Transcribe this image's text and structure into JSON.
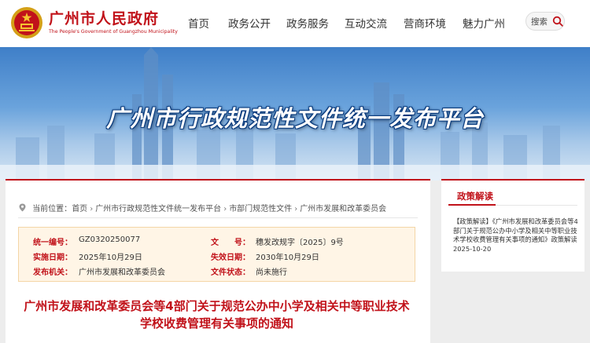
{
  "header": {
    "logo_cn": "广州市人民政府",
    "logo_en": "The People's Government of Guangzhou Municipality",
    "nav": [
      "首页",
      "政务公开",
      "政务服务",
      "互动交流",
      "营商环境",
      "魅力广州"
    ],
    "search_label": "搜索"
  },
  "banner": {
    "title": "广州市行政规范性文件统一发布平台"
  },
  "breadcrumb": {
    "prefix": "当前位置：",
    "items": [
      "首页",
      "广州市行政规范性文件统一发布平台",
      "市部门规范性文件",
      "广州市发展和改革委员会"
    ],
    "separator": "›"
  },
  "meta": {
    "serial_label": "统一编号：",
    "serial_value": "GZ0320250077",
    "docno_label": "文　　号：",
    "docno_value": "穗发改规字〔2025〕9号",
    "impl_label": "实施日期：",
    "impl_value": "2025年10月29日",
    "expire_label": "失效日期：",
    "expire_value": "2030年10月29日",
    "issuer_label": "发布机关：",
    "issuer_value": "广州市发展和改革委员会",
    "status_label": "文件状态：",
    "status_value": "尚未施行"
  },
  "document": {
    "title": "广州市发展和改革委员会等4部门关于规范公办中小学及相关中等职业技术学校收费管理有关事项的通知"
  },
  "sidebar": {
    "title": "政策解读",
    "item_text": "【政策解读】《广州市发展和改革委员会等4部门关于规范公办中小学及相关中等职业技术学校收费管理有关事项的通知》政策解读　2025-10-20"
  },
  "colors": {
    "brand_red": "#c1121a",
    "meta_bg": "#fff5e6"
  },
  "icons": {
    "emblem": "national-emblem-icon",
    "search": "search-icon",
    "location": "location-pin-icon"
  }
}
